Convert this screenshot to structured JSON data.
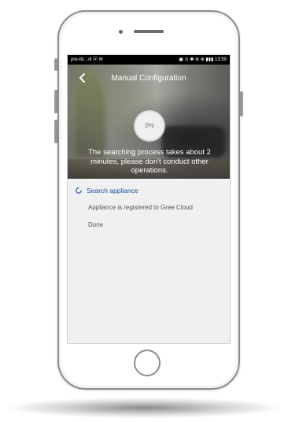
{
  "status_bar": {
    "left": "pre-tts ..ıll ⓦ ✉",
    "right": "▣ ⊙ ✱ ⊛ ⊕ ▮▮▮ 13:59"
  },
  "nav": {
    "title": "Manual Configuration",
    "back_icon": "chevron-left-icon"
  },
  "progress": {
    "label": "0%",
    "value_percent": 0
  },
  "hero": {
    "message": "The searching process takes about 2 minutes, please don't conduct other operations."
  },
  "steps": [
    {
      "label": "Search appliance",
      "state": "active",
      "icon": "loading-spinner-icon"
    },
    {
      "label": "Appliance is registered to Gree Cloud",
      "state": "pending"
    },
    {
      "label": "Done",
      "state": "pending"
    }
  ],
  "colors": {
    "active_step": "#1a4f9c",
    "pending_step": "#555555",
    "screen_background": "#f0f0f0"
  }
}
